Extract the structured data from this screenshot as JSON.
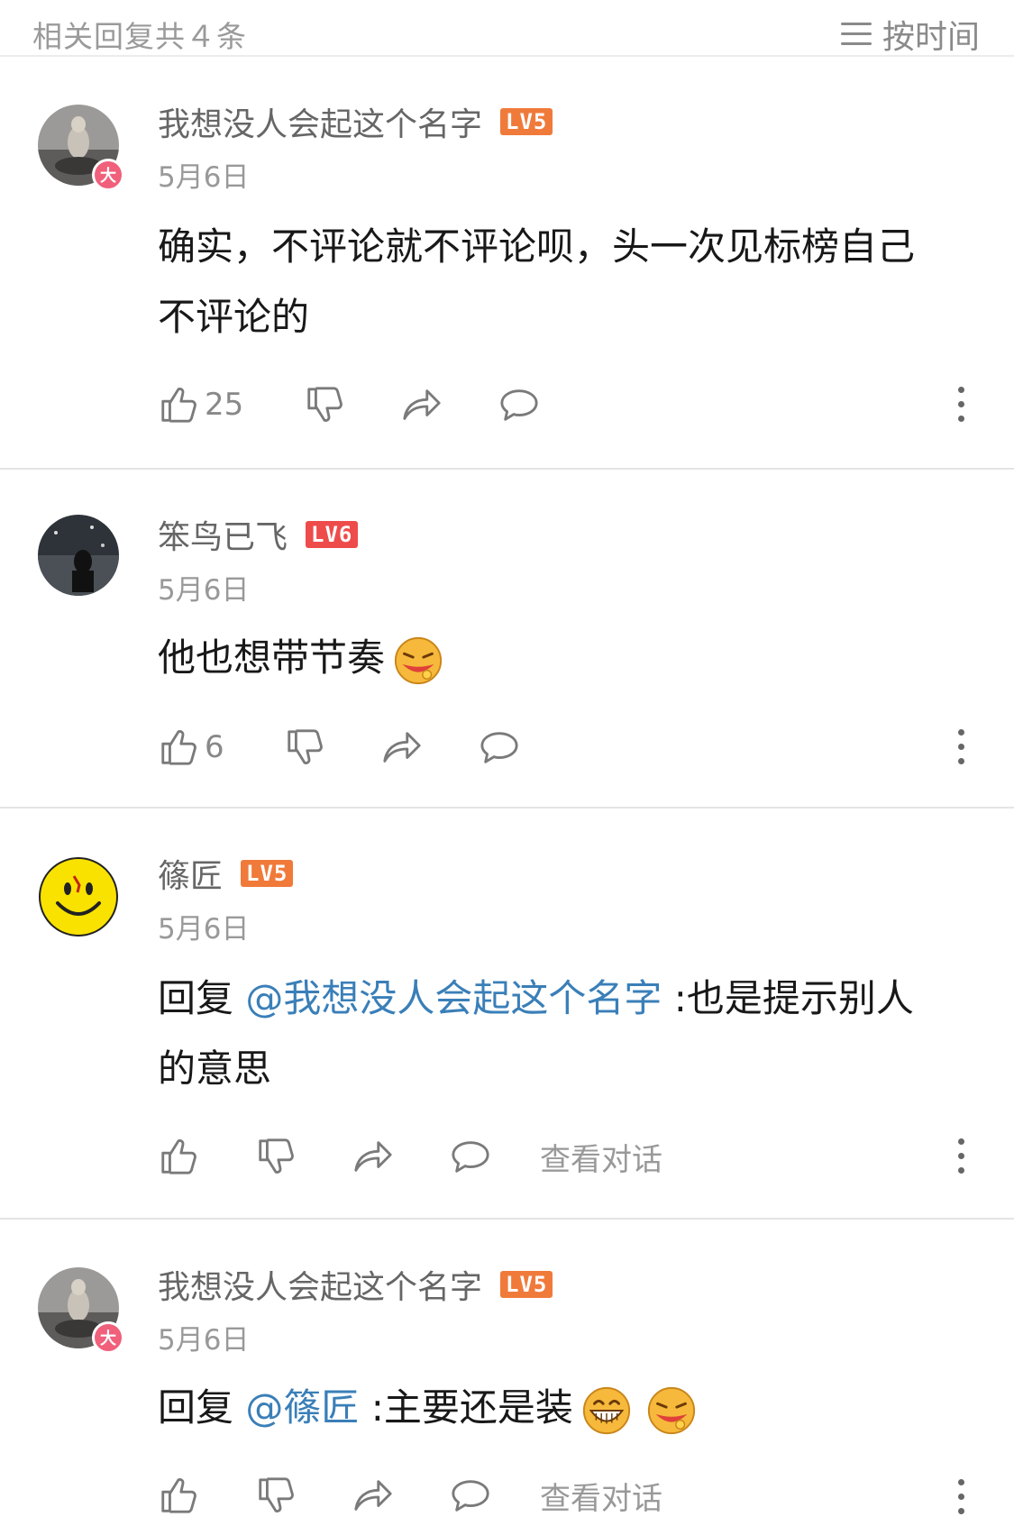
{
  "header": {
    "reply_count_label": "相关回复共４条",
    "sort_label": "按时间"
  },
  "icons": {
    "sort": "menu-lines-icon",
    "like": "thumbs-up-icon",
    "dislike": "thumbs-down-icon",
    "share": "share-arrow-icon",
    "reply": "speech-bubble-icon",
    "more": "more-vertical-icon"
  },
  "colors": {
    "mention": "#3a7fb8",
    "lv5": "#f07a3a",
    "lv6": "#ee4b4b",
    "vip_badge": "#f0607b"
  },
  "comments": [
    {
      "username": "我想没人会起这个名字",
      "level": "LV5",
      "vip_badge": "大",
      "date": "5月6日",
      "text_line1": "确实，不评论就不评论呗，头一次见标榜自己",
      "text_line2": "不评论的",
      "likes": "25"
    },
    {
      "username": "笨鸟已飞",
      "level": "LV6",
      "date": "5月6日",
      "text": "他也想带节奏",
      "emoji": "drooling-face-emoji",
      "likes": "6"
    },
    {
      "username": "篠匠",
      "level": "LV5",
      "date": "5月6日",
      "reply_prefix": "回复 ",
      "mention": "@我想没人会起这个名字",
      "text_after": " :也是提示别人",
      "text_line2": "的意思",
      "view_conversation": "查看对话"
    },
    {
      "username": "我想没人会起这个名字",
      "level": "LV5",
      "vip_badge": "大",
      "date": "5月6日",
      "reply_prefix": "回复 ",
      "mention": "@篠匠",
      "text_after": " :主要还是装",
      "emoji1": "grinning-face-emoji",
      "emoji2": "drooling-face-emoji",
      "view_conversation": "查看对话"
    }
  ]
}
